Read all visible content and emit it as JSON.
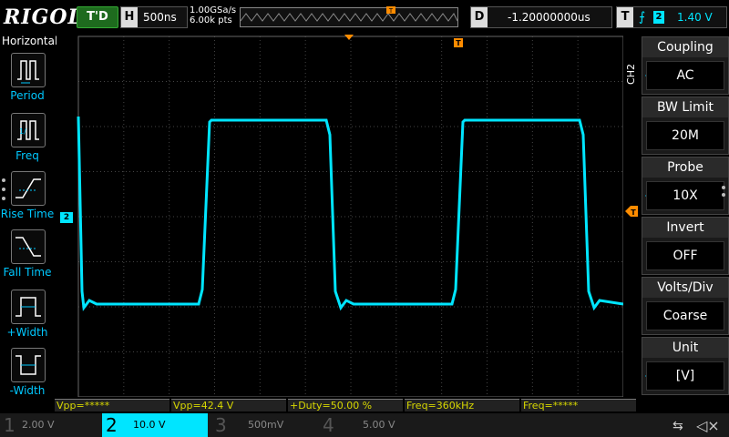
{
  "brand": "RIGOL",
  "status": "T'D",
  "horizontal": {
    "label": "H",
    "timebase": "500ns"
  },
  "acquisition": {
    "sample_rate": "1.00GSa/s",
    "points": "6.00k pts"
  },
  "delay": {
    "label": "D",
    "value": "-1.20000000us"
  },
  "trigger": {
    "label": "T",
    "edge_icon": "rising-edge-icon",
    "source": "2",
    "level": "1.40 V"
  },
  "left_menu": {
    "title": "Horizontal",
    "items": [
      {
        "label": "Period",
        "icon": "period-icon"
      },
      {
        "label": "Freq",
        "icon": "freq-icon"
      },
      {
        "label": "Rise Time",
        "icon": "rise-time-icon"
      },
      {
        "label": "Fall Time",
        "icon": "fall-time-icon"
      },
      {
        "label": "+Width",
        "icon": "pos-width-icon"
      },
      {
        "label": "-Width",
        "icon": "neg-width-icon"
      }
    ]
  },
  "right_menu": {
    "channel_tag": "CH2",
    "items": [
      {
        "header": "Coupling",
        "value": "AC",
        "has_arrow": true
      },
      {
        "header": "BW Limit",
        "value": "20M",
        "has_arrow": false
      },
      {
        "header": "Probe",
        "value": "10X",
        "has_arrow": true
      },
      {
        "header": "Invert",
        "value": "OFF",
        "has_arrow": false
      },
      {
        "header": "Volts/Div",
        "value": "Coarse",
        "has_arrow": false
      },
      {
        "header": "Unit",
        "value": "[V]",
        "has_arrow": true
      }
    ]
  },
  "channel_marker": "2",
  "measurements": [
    "Vpp=*****",
    "Vpp=42.4 V",
    "+Duty=50.00 %",
    "Freq=360kHz",
    "Freq=*****"
  ],
  "channels": [
    {
      "num": "1",
      "scale": "2.00 V",
      "color": "#d8d800",
      "active": false
    },
    {
      "num": "2",
      "scale": "10.0 V",
      "color": "#00e5ff",
      "active": true
    },
    {
      "num": "3",
      "scale": "500mV",
      "color": "#e040e0",
      "active": false
    },
    {
      "num": "4",
      "scale": "5.00 V",
      "color": "#3070ff",
      "active": false
    }
  ],
  "trace_color": "#00e5ff",
  "colors": {
    "accent": "#00c8ff",
    "trigger_marker": "#ff8c00",
    "grid": "#444444"
  }
}
